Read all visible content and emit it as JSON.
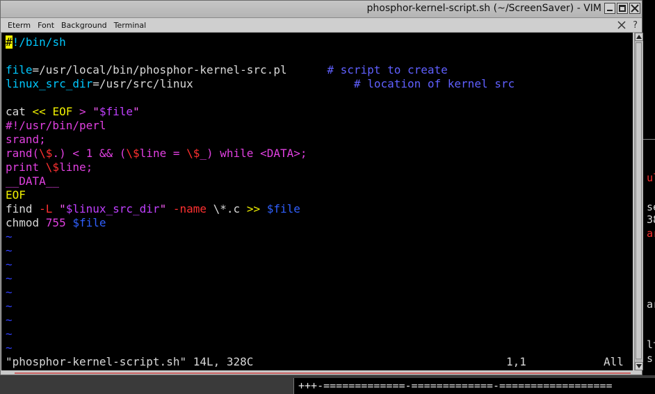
{
  "window": {
    "title": "phosphor-kernel-script.sh (~/ScreenSaver) - VIM"
  },
  "menubar": {
    "items": [
      "Eterm",
      "Font",
      "Background",
      "Terminal"
    ]
  },
  "editor": {
    "lines": [
      [
        {
          "t": "#",
          "c": "cursor"
        },
        {
          "t": "!/bin/sh",
          "c": "c-ident"
        }
      ],
      [],
      [
        {
          "t": "file",
          "c": "c-ident"
        },
        {
          "t": "=/usr/local/bin/phosphor-kernel-src.pl      ",
          "c": "c-def"
        },
        {
          "t": "# script to create",
          "c": "c-comment"
        }
      ],
      [
        {
          "t": "linux_src_dir",
          "c": "c-ident"
        },
        {
          "t": "=/usr/src/linux                        ",
          "c": "c-def"
        },
        {
          "t": "# location of kernel src",
          "c": "c-comment"
        }
      ],
      [],
      [
        {
          "t": "cat ",
          "c": "c-def"
        },
        {
          "t": "<< ",
          "c": "c-yellow"
        },
        {
          "t": "EOF",
          "c": "c-yellow"
        },
        {
          "t": " > ",
          "c": "c-magenta"
        },
        {
          "t": "\"",
          "c": "c-pink"
        },
        {
          "t": "$file",
          "c": "c-purple"
        },
        {
          "t": "\"",
          "c": "c-pink"
        }
      ],
      [
        {
          "t": "#!/usr/bin/perl",
          "c": "c-magenta"
        }
      ],
      [
        {
          "t": "srand;",
          "c": "c-magenta"
        }
      ],
      [
        {
          "t": "rand(",
          "c": "c-magenta"
        },
        {
          "t": "\\$",
          "c": "c-red"
        },
        {
          "t": ".) < 1 && (",
          "c": "c-magenta"
        },
        {
          "t": "\\$",
          "c": "c-red"
        },
        {
          "t": "line = ",
          "c": "c-magenta"
        },
        {
          "t": "\\$",
          "c": "c-red"
        },
        {
          "t": "_) while <DATA>;",
          "c": "c-magenta"
        }
      ],
      [
        {
          "t": "print ",
          "c": "c-magenta"
        },
        {
          "t": "\\$",
          "c": "c-red"
        },
        {
          "t": "line;",
          "c": "c-magenta"
        }
      ],
      [
        {
          "t": "__DATA__",
          "c": "c-magenta"
        }
      ],
      [
        {
          "t": "EOF",
          "c": "c-yellow"
        }
      ],
      [
        {
          "t": "find ",
          "c": "c-def"
        },
        {
          "t": "-L",
          "c": "c-red"
        },
        {
          "t": " \"",
          "c": "c-pink"
        },
        {
          "t": "$linux_src_dir",
          "c": "c-purple"
        },
        {
          "t": "\"",
          "c": "c-pink"
        },
        {
          "t": " ",
          "c": "c-def"
        },
        {
          "t": "-name",
          "c": "c-red"
        },
        {
          "t": " \\*.c ",
          "c": "c-def"
        },
        {
          "t": ">> ",
          "c": "c-yellow"
        },
        {
          "t": "$file",
          "c": "c-blue"
        }
      ],
      [
        {
          "t": "chmod ",
          "c": "c-def"
        },
        {
          "t": "755",
          "c": "c-magenta"
        },
        {
          "t": " ",
          "c": "c-def"
        },
        {
          "t": "$file",
          "c": "c-blue"
        }
      ],
      [
        {
          "t": "~",
          "c": "c-tilde"
        }
      ],
      [
        {
          "t": "~",
          "c": "c-tilde"
        }
      ],
      [
        {
          "t": "~",
          "c": "c-tilde"
        }
      ],
      [
        {
          "t": "~",
          "c": "c-tilde"
        }
      ],
      [
        {
          "t": "~",
          "c": "c-tilde"
        }
      ],
      [
        {
          "t": "~",
          "c": "c-tilde"
        }
      ],
      [
        {
          "t": "~",
          "c": "c-tilde"
        }
      ],
      [
        {
          "t": "~",
          "c": "c-tilde"
        }
      ],
      [
        {
          "t": "~",
          "c": "c-tilde"
        }
      ]
    ],
    "status": {
      "file_info": "\"phosphor-kernel-script.sh\" 14L, 328C",
      "ruler": "1,1",
      "position": "All"
    }
  },
  "background": {
    "right_fragments": [
      {
        "text": "ul",
        "color": "#ff3030"
      },
      {
        "text": "se",
        "color": "#d8d8d8"
      },
      {
        "text": "38",
        "color": "#d8d8d8"
      },
      {
        "text": "ar",
        "color": "#ff3030"
      },
      {
        "text": "ar",
        "color": "#d8d8d8"
      },
      {
        "text": "lt",
        "color": "#d8d8d8"
      },
      {
        "text": "s",
        "color": "#d8d8d8"
      }
    ],
    "bottom_term_text": "+++-=============-=============-=================="
  },
  "colors": {
    "cursor": "#f0f000",
    "identifier": "#00c8ff",
    "comment": "#6060ff",
    "here_doc": "#e040e0",
    "special": "#ff3030",
    "tilde": "#3040ff"
  }
}
